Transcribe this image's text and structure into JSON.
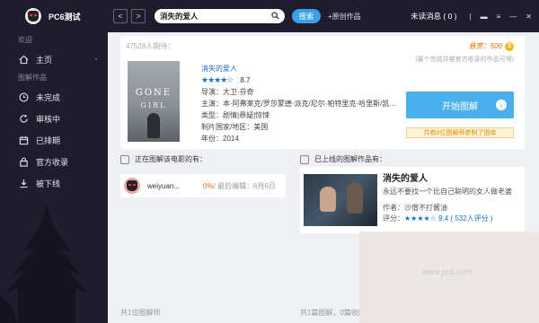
{
  "user": {
    "name": "PC6测试"
  },
  "sidebar": {
    "section1": "欢迎",
    "home": "主页",
    "section2": "图解作品",
    "items": [
      {
        "label": "未完成",
        "icon": "clock-icon"
      },
      {
        "label": "审核中",
        "icon": "refresh-icon"
      },
      {
        "label": "已排期",
        "icon": "calendar-icon"
      },
      {
        "label": "官方收录",
        "icon": "lock-icon"
      },
      {
        "label": "被下线",
        "icon": "download-icon"
      }
    ]
  },
  "topbar": {
    "back": "<",
    "forward": ">",
    "search_value": "消失的爱人",
    "search_button": "搜索",
    "upload": "+原创作品",
    "unread": "未读消息 ( 0 )",
    "win_controls": [
      "|",
      "▬",
      "≡",
      "—",
      "✕"
    ]
  },
  "movie": {
    "ask_count": "47528人期待：",
    "reward_label": "悬赏：500",
    "reward_note": "(最个完成并被官方收录的作品可得)",
    "poster_title": "GONE",
    "poster_subtitle": "GIRL",
    "title": "消失的爱人",
    "stars": "★★★★☆",
    "rating": "8.7",
    "director": "导演：大卫·芬奇",
    "cast": "主演：本·阿弗莱克/罗莎蒙德·派克/尼尔·帕特里克·哈里斯/凯莉·库恩/...",
    "genre": "类型：剧情|悬疑|惊悚",
    "region": "制片国家/地区：美国",
    "year": "年份：2014",
    "start_button": "开始图解",
    "start_note": "共有0位图解师参制了图库"
  },
  "panels": {
    "in_progress_head": "正在图解该电影的有：",
    "published_head": "已上线的图解作品有：",
    "user_name": "weiyuan...",
    "user_pct": "0%",
    "user_last": " / 最后编辑：6月6日",
    "footer_left": "共1位图解师",
    "footer_mid": "共1篇图解，0篇收图"
  },
  "work": {
    "title": "消失的爱人",
    "desc": "永远不要找一个比自己聪明的女人做老婆",
    "author": "作者：沙僧不打酱油",
    "score_label": "评分：",
    "stars": "★★★★☆",
    "score": "9.4 ( 532人评分 )"
  },
  "watermark": "www.pc6.com",
  "colors": {
    "sidebar": "#1f1c2e",
    "accent": "#3aa0e8",
    "reward": "#e56a00"
  }
}
